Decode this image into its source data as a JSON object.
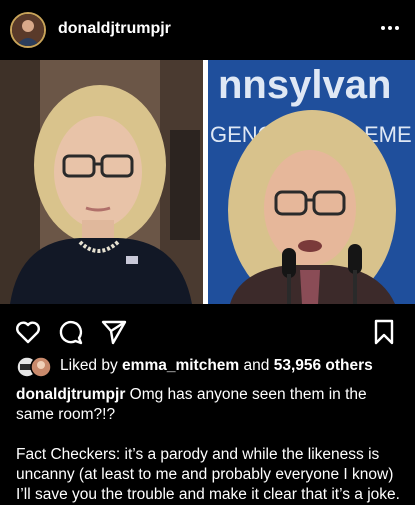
{
  "post": {
    "username": "donaldjtrumpjr",
    "more_icon": "more-horizontal-icon",
    "likes": {
      "prefix": "Liked by ",
      "user": "emma_mitchem",
      "middle": " and ",
      "count": "53,956 others"
    },
    "caption": {
      "author": "donaldjtrumpjr",
      "text": " Omg has anyone seen them in the same room?!?\n\nFact Checkers: it’s a parody and while the likeness is uncanny (at least to me and probably everyone I know) I’ll save you the trouble and make it clear that it’s a joke."
    },
    "photo_text": {
      "sign_top": "nnsylvan",
      "sign_bottom_left": "GENC",
      "sign_bottom_right": "EME"
    }
  },
  "actions": {
    "like_icon": "heart-icon",
    "comment_icon": "comment-icon",
    "share_icon": "send-icon",
    "save_icon": "bookmark-icon"
  },
  "colors": {
    "background": "#000000",
    "text": "#ffffff",
    "sign_blue": "#1f4f9c"
  }
}
